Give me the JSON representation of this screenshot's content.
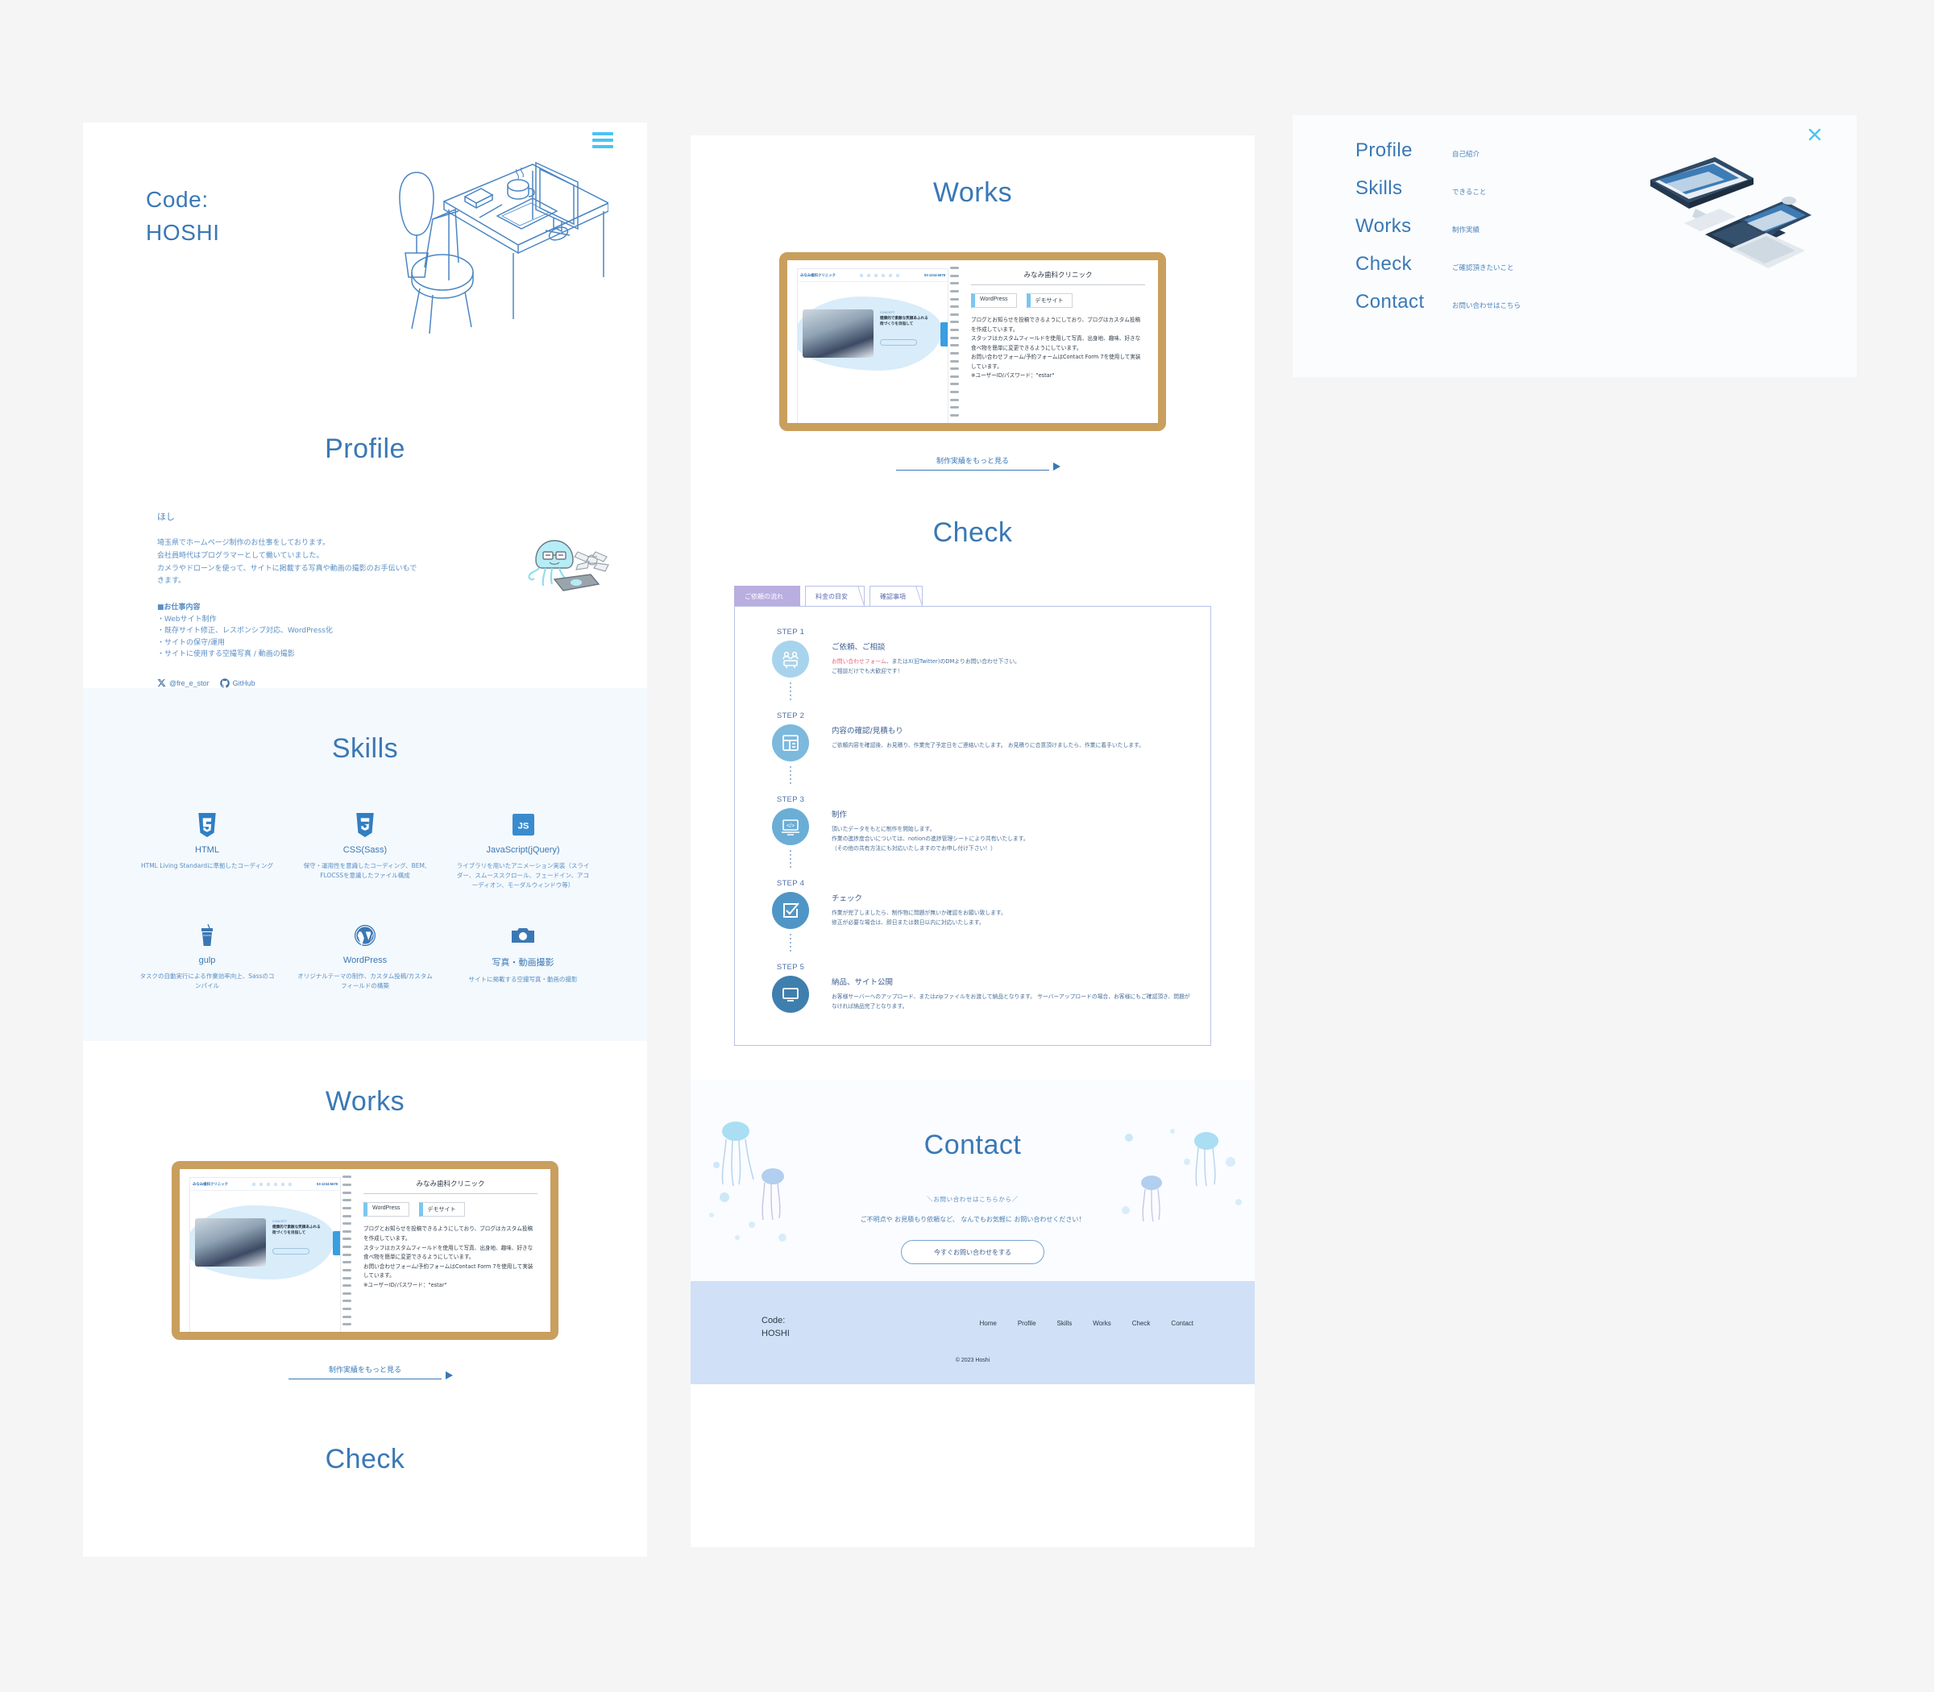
{
  "brand": {
    "line1": "Code:",
    "line2": "HOSHI"
  },
  "hero": {
    "menu_icon": "hamburger-icon",
    "illustration": "desk-workspace-illustration"
  },
  "sections": {
    "profile_title": "Profile",
    "skills_title": "Skills",
    "works_title": "Works",
    "check_title": "Check",
    "contact_title": "Contact"
  },
  "profile": {
    "name": "ほし",
    "intro": "埼玉県でホームページ制作のお仕事をしております。\n会社員時代はプログラマーとして働いていました。\nカメラやドローンを使って、サイトに掲載する写真や動画の撮影のお手伝いもできます。",
    "work_heading": "■お仕事内容",
    "work_items": [
      "・Webサイト制作",
      "・既存サイト修正、レスポンシブ対応、WordPress化",
      "・サイトの保守/運用",
      "・サイトに使用する空撮写真 / 動画の撮影"
    ],
    "social": [
      {
        "icon": "x-twitter-icon",
        "label": "@fre_e_stor"
      },
      {
        "icon": "github-icon",
        "label": "GitHub"
      }
    ],
    "mascot": "jellyfish-mascot-illustration"
  },
  "skills": [
    {
      "icon": "html5-icon",
      "name": "HTML",
      "desc": "HTML Living Standardに準拠したコーディング"
    },
    {
      "icon": "css3-icon",
      "name": "CSS(Sass)",
      "desc": "保守・運用性を意識したコーディング、BEM, FLOCSSを意識したファイル構成"
    },
    {
      "icon": "javascript-icon",
      "name": "JavaScript(jQuery)",
      "desc": "ライブラリを用いたアニメーション実装（スライダー、スムーススクロール、フェードイン、アコーディオン、モーダルウィンドウ等）"
    },
    {
      "icon": "gulp-icon",
      "name": "gulp",
      "desc": "タスクの自動実行による作業効率向上、Sassのコンパイル"
    },
    {
      "icon": "wordpress-icon",
      "name": "WordPress",
      "desc": "オリジナルテーマの制作、カスタム投稿/カスタムフィールドの構築"
    },
    {
      "icon": "camera-icon",
      "name": "写真・動画撮影",
      "desc": "サイトに掲載する空撮写真・動画の撮影"
    }
  ],
  "works": {
    "card": {
      "title": "みなみ歯科クリニック",
      "badges": [
        "WordPress",
        "デモサイト"
      ],
      "description": "ブログとお知らせを投稿できるようにしており、ブログはカスタム投稿を作成しています。\nスタッフはカスタムフィールドを使用して写真、出身地、趣味、好きな食べ物を簡単に変更できるようにしています。\nお問い合わせフォーム/予約フォームはContact Form 7を使用して実装しています。\n※ユーザーID/パスワード：\"estar\"",
      "thumb": {
        "logo": "みなみ歯科クリニック",
        "tel": "03-1234-5678",
        "eyebrow": "CONCEPT",
        "headline": "健康的で素敵な笑顔あふれる\n街づくりを目指して"
      }
    },
    "more_label": "制作実績をもっと見る"
  },
  "check": {
    "tabs": [
      {
        "label": "ご依頼の流れ",
        "active": true
      },
      {
        "label": "料金の目安",
        "active": false
      },
      {
        "label": "確認事項",
        "active": false
      }
    ],
    "steps": [
      {
        "no": "STEP 1",
        "icon": "consultation-icon",
        "color": "#a8d3ec",
        "title": "ご依頼、ご相談",
        "desc_highlight": "お問い合わせフォーム",
        "desc_mid": "、または",
        "desc_link": "X(旧Twitter)",
        "desc_rest": "のDMよりお問い合わせ下さい。",
        "desc_line2": "ご相談だけでも大歓迎です！"
      },
      {
        "no": "STEP 2",
        "icon": "document-estimate-icon",
        "color": "#7cb9dd",
        "title": "内容の確認/見積もり",
        "desc_line1": "ご依頼内容を確認後、お見積り、作業完了予定日をご連絡いたします。 お見積りに合意頂けましたら、作業に着手いたします。"
      },
      {
        "no": "STEP 3",
        "icon": "code-laptop-icon",
        "color": "#6aaed6",
        "title": "制作",
        "desc_line1": "頂いたデータをもとに制作を開始します。",
        "desc_line2": "作業の進捗度合いについては、notionの進捗管理シートにより共有いたします。",
        "desc_line3": "（その他の共有方法にも対応いたしますのでお申し付け下さい！）"
      },
      {
        "no": "STEP 4",
        "icon": "checkbox-icon",
        "color": "#4f96c6",
        "title": "チェック",
        "desc_line1": "作業が完了しましたら、制作物に問題が無いか確認をお願い致します。",
        "desc_line2": "修正が必要な場合は、即日または数日以内に対応いたします。"
      },
      {
        "no": "STEP 5",
        "icon": "monitor-icon",
        "color": "#3f7fae",
        "title": "納品、サイト公開",
        "desc_line1": "お客様サーバーへのアップロード、またはzipファイルをお渡して納品となります。 サーバーアップロードの場合、お客様にもご確認頂き、問題がなければ納品完了となります。"
      }
    ]
  },
  "contact": {
    "lead": "＼お問い合わせはこちらから／",
    "sub": "ご不明点や お見積もり依頼など、 なんでもお気軽に お問い合わせください！",
    "button": "今すぐお問い合わせをする",
    "decor": "jellyfish-bubbles-illustration"
  },
  "footer": {
    "brand_line1": "Code:",
    "brand_line2": "HOSHI",
    "nav": [
      "Home",
      "Profile",
      "Skills",
      "Works",
      "Check",
      "Contact"
    ],
    "copyright": "© 2023 Hoshi"
  },
  "nav_overlay": {
    "close_icon": "close-icon",
    "illustration": "desktop-laptop-isometric-illustration",
    "items": [
      {
        "en": "Profile",
        "jp": "自己紹介"
      },
      {
        "en": "Skills",
        "jp": "できること"
      },
      {
        "en": "Works",
        "jp": "制作実績"
      },
      {
        "en": "Check",
        "jp": "ご確認頂きたいこと"
      },
      {
        "en": "Contact",
        "jp": "お問い合わせはこちら"
      }
    ]
  },
  "colors": {
    "primary": "#3a78b5",
    "accent": "#4cc3f5",
    "notebook": "#c99f5e",
    "tab_active": "#b9aee0",
    "footer_bg": "#cfe0f7"
  }
}
